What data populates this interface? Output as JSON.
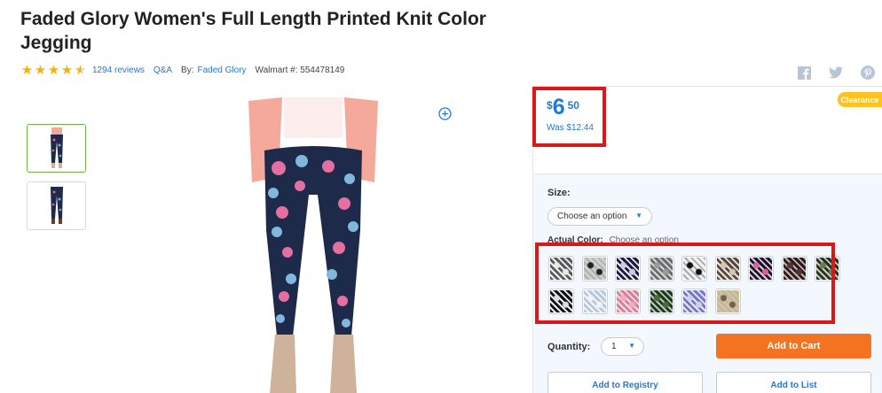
{
  "product": {
    "title": "Faded Glory Women's Full Length Printed Knit Color Jegging",
    "rating": 4.5,
    "reviews": "1294 reviews",
    "qa": "Q&A",
    "by_label": "By:",
    "brand": "Faded Glory",
    "walmart_number": "Walmart #: 554478149"
  },
  "social": {
    "icons": [
      "facebook-icon",
      "twitter-icon",
      "pinterest-icon"
    ]
  },
  "price": {
    "currency": "$",
    "dollars": "6",
    "cents": "50",
    "was": "Was $12.44"
  },
  "badge": {
    "label": "Clearance"
  },
  "size": {
    "label": "Size:",
    "select_value": "Choose an option"
  },
  "color": {
    "label": "Actual Color:",
    "choose": "Choose an option"
  },
  "swatches": [
    {
      "bg": "#5a5a5a",
      "pattern": "#e8e8e8"
    },
    {
      "bg": "#cfcfcf",
      "pattern": "#222222"
    },
    {
      "bg": "#1d1d3a",
      "pattern": "#c9c9e8"
    },
    {
      "bg": "#6d6d6d",
      "pattern": "#9a9a9a"
    },
    {
      "bg": "#f2f2f2",
      "pattern": "#111111"
    },
    {
      "bg": "#5a4a3a",
      "pattern": "#d6c6b0"
    },
    {
      "bg": "#101830",
      "pattern": "#e06090"
    },
    {
      "bg": "#2a1a1a",
      "pattern": "#5a3030"
    },
    {
      "bg": "#2a3020",
      "pattern": "#6a7a50"
    },
    {
      "bg": "#111111",
      "pattern": "#dddddd"
    },
    {
      "bg": "#b8c8d8",
      "pattern": "#f0f4f8"
    },
    {
      "bg": "#d88098",
      "pattern": "#e8b0c0"
    },
    {
      "bg": "#1e3a1e",
      "pattern": "#4a6a3a"
    },
    {
      "bg": "#7a78c0",
      "pattern": "#cfd0f0"
    },
    {
      "bg": "#c8b890",
      "pattern": "#7a6040"
    }
  ],
  "quantity": {
    "label": "Quantity:",
    "value": "1"
  },
  "buttons": {
    "add_to_cart": "Add to Cart",
    "add_to_registry": "Add to Registry",
    "add_to_list": "Add to List"
  },
  "colors": {
    "link": "#1f7ad1",
    "star": "#f6b10c",
    "cart": "#f47321",
    "highlight": "#d61a1a",
    "clearance": "#ffc220"
  }
}
